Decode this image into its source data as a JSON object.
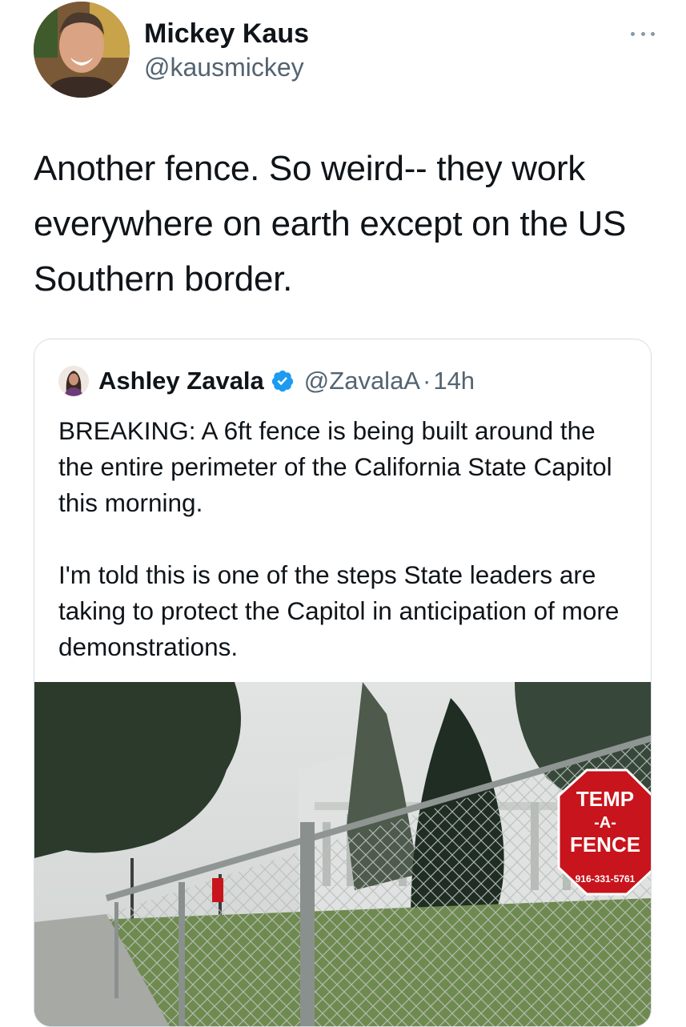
{
  "author": {
    "name": "Mickey Kaus",
    "handle": "@kausmickey",
    "avatar_icon": "user-avatar-icon",
    "more_icon": "more-options-icon"
  },
  "tweet": {
    "text": "Another fence. So weird-- they work everywhere on earth except on the US Southern border."
  },
  "quoted_tweet": {
    "name": "Ashley Zavala",
    "verified": true,
    "handle": "@ZavalaA",
    "separator": "·",
    "time": "14h",
    "paragraph_1": "BREAKING: A 6ft fence is being built around the the entire perimeter of the California State Capitol this morning.",
    "paragraph_2": "I'm told this is one of the steps State leaders are taking to protect the Capitol in anticipation of more demonstrations.",
    "image": {
      "sign_line_1": "TEMP",
      "sign_line_2": "-A-",
      "sign_line_3": "FENCE",
      "sign_phone": "916-331-5761"
    }
  },
  "colors": {
    "text_primary": "#0f1419",
    "text_secondary": "#536471",
    "verified_blue": "#1d9bf0",
    "border": "#d6dde3",
    "sign_red": "#c8141c"
  }
}
